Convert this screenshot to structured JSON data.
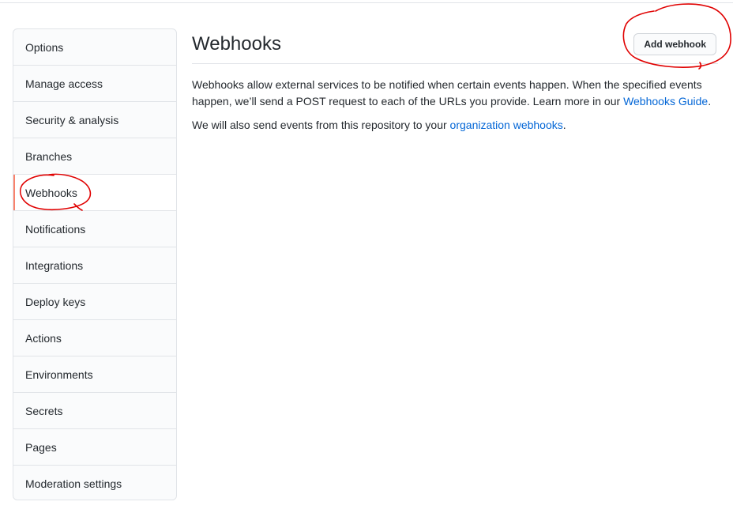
{
  "sidebar": {
    "items": [
      {
        "label": "Options"
      },
      {
        "label": "Manage access"
      },
      {
        "label": "Security & analysis"
      },
      {
        "label": "Branches"
      },
      {
        "label": "Webhooks"
      },
      {
        "label": "Notifications"
      },
      {
        "label": "Integrations"
      },
      {
        "label": "Deploy keys"
      },
      {
        "label": "Actions"
      },
      {
        "label": "Environments"
      },
      {
        "label": "Secrets"
      },
      {
        "label": "Pages"
      },
      {
        "label": "Moderation settings"
      }
    ],
    "selected_index": 4
  },
  "main": {
    "title": "Webhooks",
    "add_button_label": "Add webhook",
    "description": {
      "text": "Webhooks allow external services to be notified when certain events happen. When the specified events happen, we’ll send a POST request to each of the URLs you provide. Learn more in our ",
      "link_text": "Webhooks Guide",
      "suffix": "."
    },
    "org_note": {
      "text": "We will also send events from this repository to your ",
      "link_text": "organization webhooks",
      "suffix": "."
    }
  },
  "colors": {
    "link": "#0366d6",
    "selected_accent": "#f9826c",
    "annotation": "#e00000"
  }
}
